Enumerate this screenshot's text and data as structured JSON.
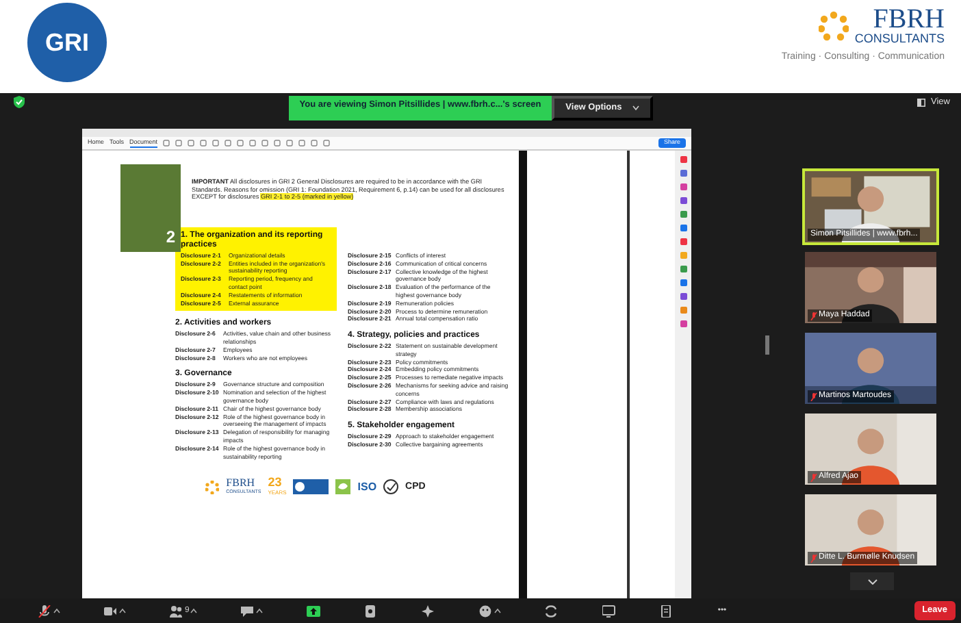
{
  "banner": {
    "left_logo": "GRI",
    "right_logo": {
      "name": "FBRH",
      "subtitle": "CONSULTANTS",
      "tagline": "Training · Consulting · Communication"
    }
  },
  "meeting_bar": {
    "notice": "You are viewing Simon Pitsillides | www.fbrh.c...'s screen",
    "view_options": "View Options",
    "view": "View"
  },
  "pdf": {
    "tabs": [
      {
        "label": "Home",
        "selected": false
      },
      {
        "label": "Tools",
        "selected": false
      },
      {
        "label": "Document",
        "selected": true
      }
    ],
    "share": "Share",
    "cover_number": "2",
    "notice": "**IMPORTANT** All disclosures in GRI 2 General Disclosures are required to be in accordance with the GRI Standards. Reasons for omission (GRI 1: Foundation 2021, Requirement 6, p.14) can be used for all disclosures EXCEPT for disclosures",
    "notice_highlight": "GRI 2-1 to 2-5 (marked in yellow)",
    "columns": [
      [
        {
          "title": "1. The organization and its reporting practices",
          "highlighted": true,
          "items": [
            {
              "code": "Disclosure 2-1",
              "text": "Organizational details"
            },
            {
              "code": "Disclosure 2-2",
              "text": "Entities included in the organization's sustainability reporting"
            },
            {
              "code": "Disclosure 2-3",
              "text": "Reporting period, frequency and contact point"
            },
            {
              "code": "Disclosure 2-4",
              "text": "Restatements of information"
            },
            {
              "code": "Disclosure 2-5",
              "text": "External assurance"
            }
          ]
        },
        {
          "title": "2. Activities and workers",
          "highlighted": false,
          "items": [
            {
              "code": "Disclosure 2-6",
              "text": "Activities, value chain and other business relationships"
            },
            {
              "code": "Disclosure 2-7",
              "text": "Employees"
            },
            {
              "code": "Disclosure 2-8",
              "text": "Workers who are not employees"
            }
          ]
        },
        {
          "title": "3. Governance",
          "highlighted": false,
          "items": [
            {
              "code": "Disclosure 2-9",
              "text": "Governance structure and composition"
            },
            {
              "code": "Disclosure 2-10",
              "text": "Nomination and selection of the highest governance body"
            },
            {
              "code": "Disclosure 2-11",
              "text": "Chair of the highest governance body"
            },
            {
              "code": "Disclosure 2-12",
              "text": "Role of the highest governance body in overseeing the management of impacts"
            },
            {
              "code": "Disclosure 2-13",
              "text": "Delegation of responsibility for managing impacts"
            },
            {
              "code": "Disclosure 2-14",
              "text": "Role of the highest governance body in sustainability reporting"
            }
          ]
        }
      ],
      [
        {
          "highlighted": false,
          "items": [
            {
              "code": "Disclosure 2-15",
              "text": "Conflicts of interest"
            },
            {
              "code": "Disclosure 2-16",
              "text": "Communication of critical concerns"
            },
            {
              "code": "Disclosure 2-17",
              "text": "Collective knowledge of the highest governance body"
            },
            {
              "code": "Disclosure 2-18",
              "text": "Evaluation of the performance of the highest governance body"
            },
            {
              "code": "Disclosure 2-19",
              "text": "Remuneration policies"
            },
            {
              "code": "Disclosure 2-20",
              "text": "Process to determine remuneration"
            },
            {
              "code": "Disclosure 2-21",
              "text": "Annual total compensation ratio"
            }
          ]
        },
        {
          "title": "4. Strategy, policies and practices",
          "highlighted": false,
          "items": [
            {
              "code": "Disclosure 2-22",
              "text": "Statement on sustainable development strategy"
            },
            {
              "code": "Disclosure 2-23",
              "text": "Policy commitments"
            },
            {
              "code": "Disclosure 2-24",
              "text": "Embedding policy commitments"
            },
            {
              "code": "Disclosure 2-25",
              "text": "Processes to remediate negative impacts"
            },
            {
              "code": "Disclosure 2-26",
              "text": "Mechanisms for seeking advice and raising concerns"
            },
            {
              "code": "Disclosure 2-27",
              "text": "Compliance with laws and regulations"
            },
            {
              "code": "Disclosure 2-28",
              "text": "Membership associations"
            }
          ]
        },
        {
          "title": "5. Stakeholder engagement",
          "highlighted": false,
          "items": [
            {
              "code": "Disclosure 2-29",
              "text": "Approach to stakeholder engagement"
            },
            {
              "code": "Disclosure 2-30",
              "text": "Collective bargaining agreements"
            }
          ]
        }
      ]
    ],
    "footer": {
      "brand": "FBRH",
      "brand_sub": "CONSULTANTS",
      "years": "23",
      "years_label": "YEARS",
      "iso": "ISO",
      "cpd": "CPD"
    }
  },
  "participants": [
    {
      "name": "Simon Pitsillides | www.fbrh...",
      "selected": true,
      "muted": false
    },
    {
      "name": "Maya Haddad",
      "selected": false,
      "muted": true
    },
    {
      "name": "Martinos Martoudes",
      "selected": false,
      "muted": true
    },
    {
      "name": "Alfred Ajao",
      "selected": false,
      "muted": true
    },
    {
      "name": "Ditte L. Burmølle Knudsen",
      "selected": false,
      "muted": true
    }
  ],
  "toolbar": [
    {
      "kind": "mic",
      "muted": true,
      "caret": true
    },
    {
      "kind": "video",
      "caret": true
    },
    {
      "kind": "participants",
      "count": "9",
      "caret": true
    },
    {
      "kind": "chat",
      "caret": true
    },
    {
      "kind": "share",
      "caret": false
    },
    {
      "kind": "apps",
      "caret": false
    },
    {
      "kind": "ai",
      "caret": false
    },
    {
      "kind": "reactions",
      "caret": true
    },
    {
      "kind": "switch",
      "caret": false
    },
    {
      "kind": "whiteboard",
      "caret": false
    },
    {
      "kind": "notes",
      "caret": false
    },
    {
      "kind": "more",
      "label": "•••",
      "caret": false
    }
  ],
  "leave": "Leave"
}
